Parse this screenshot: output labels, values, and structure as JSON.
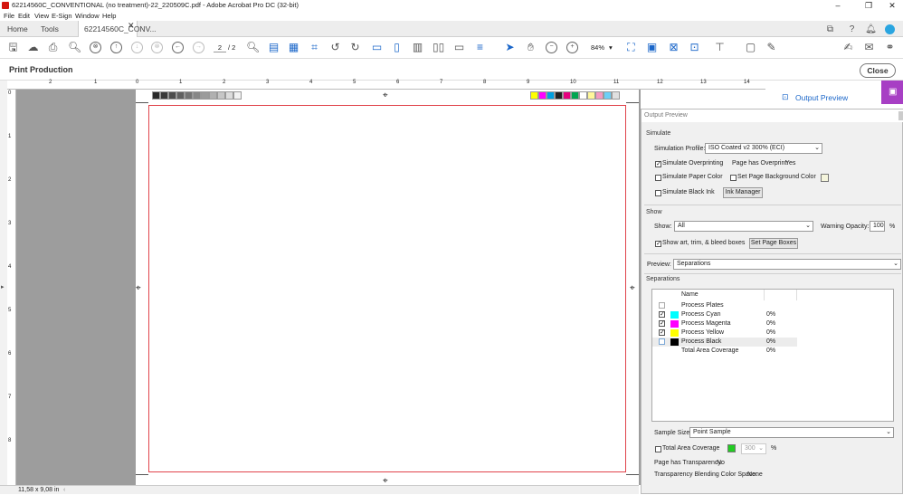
{
  "window": {
    "title": "62214560C_CONVENTIONAL (no treatment)-22_220509C.pdf - Adobe Acrobat Pro DC (32-bit)",
    "minimize": "–",
    "restore": "❐",
    "close": "✕"
  },
  "menu": [
    "File",
    "Edit",
    "View",
    "E-Sign",
    "Window",
    "Help"
  ],
  "tabs": {
    "home": "Home",
    "tools": "Tools",
    "document": "62214560C_CONV..."
  },
  "toolbar": {
    "page_current": "2",
    "page_total": "/ 2",
    "zoom": "84%"
  },
  "print_production": {
    "title": "Print Production",
    "close": "Close"
  },
  "right_panel": {
    "output_preview_link": "Output Preview"
  },
  "ruler": {
    "h_ticks": [
      "2",
      "1",
      "0",
      "1",
      "2",
      "3",
      "4",
      "5",
      "6",
      "7",
      "8",
      "9",
      "10",
      "11",
      "12",
      "13",
      "14"
    ],
    "v_ticks": [
      "0",
      "1",
      "2",
      "3",
      "4",
      "5",
      "6",
      "7",
      "8"
    ]
  },
  "status": {
    "page_size": "11,58 x 9,08 in"
  },
  "output_preview": {
    "window_title": "Output Preview",
    "simulate": {
      "group": "Simulate",
      "profile_label": "Simulation Profile:",
      "profile_value": "ISO Coated v2 300% (ECI)",
      "simulate_overprinting": "Simulate Overprinting",
      "simulate_overprinting_checked": true,
      "page_has_overprint_label": "Page has Overprint:",
      "page_has_overprint_value": "Yes",
      "simulate_paper_color": "Simulate Paper Color",
      "set_page_bg_color": "Set Page Background Color",
      "simulate_black_ink": "Simulate Black Ink",
      "ink_manager": "Ink Manager"
    },
    "show": {
      "group": "Show",
      "show_label": "Show:",
      "show_value": "All",
      "warning_opacity_label": "Warning Opacity:",
      "warning_opacity_value": "100",
      "percent": "%",
      "show_boxes": "Show art, trim, & bleed boxes",
      "show_boxes_checked": true,
      "set_page_boxes": "Set Page Boxes"
    },
    "preview": {
      "label": "Preview:",
      "value": "Separations"
    },
    "separations": {
      "group": "Separations",
      "header_name": "Name",
      "rows": [
        {
          "name": "Process Plates",
          "value": "",
          "checked": false,
          "color": ""
        },
        {
          "name": "Process Cyan",
          "value": "0%",
          "checked": true,
          "color": "#00ffff"
        },
        {
          "name": "Process Magenta",
          "value": "0%",
          "checked": true,
          "color": "#ff00ff"
        },
        {
          "name": "Process Yellow",
          "value": "0%",
          "checked": true,
          "color": "#ffff00"
        },
        {
          "name": "Process Black",
          "value": "0%",
          "checked": false,
          "color": "#000000"
        },
        {
          "name": "Total Area Coverage",
          "value": "0%",
          "checked": false,
          "color": ""
        }
      ]
    },
    "sample_size": {
      "label": "Sample Size:",
      "value": "Point Sample"
    },
    "total_area_coverage": {
      "label": "Total Area Coverage",
      "value": "300",
      "percent": "%"
    },
    "transparency": {
      "label": "Page has Transparency:",
      "value": "No"
    },
    "blending": {
      "label": "Transparency Blending Color Space:",
      "value": "None"
    }
  },
  "colors": {
    "accent": "#1a66c9",
    "rightbar": "#a73fc4",
    "trim": "#e0434b",
    "gray": "#9d9d9d"
  },
  "color_bar": [
    "#ffff00",
    "#ff00ff",
    "#00a0e0",
    "#222222",
    "#e6007e",
    "#00a651",
    "#ffffff",
    "#fff799",
    "#f49ac1",
    "#6dcff6",
    "#e0e0e0"
  ],
  "gray_bar": [
    "#2a2a2a",
    "#3b3b3b",
    "#4d4d4d",
    "#606060",
    "#737373",
    "#878787",
    "#9b9b9b",
    "#b0b0b0",
    "#c6c6c6",
    "#dcdcdc",
    "#f2f2f2"
  ]
}
